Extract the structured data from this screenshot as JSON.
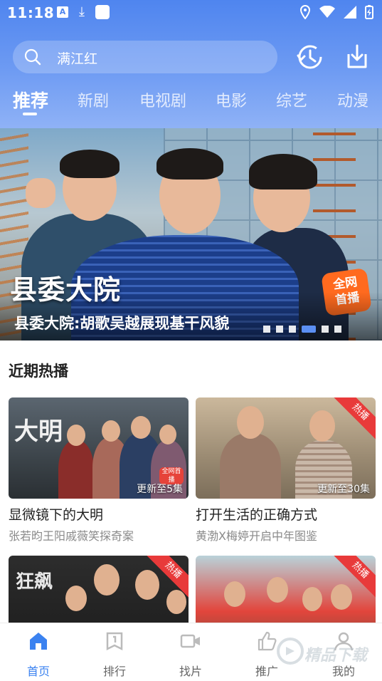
{
  "status_bar": {
    "time": "11:18",
    "left_badge": "A"
  },
  "search": {
    "placeholder": "满江红"
  },
  "tabs": [
    {
      "label": "推荐",
      "active": true
    },
    {
      "label": "新剧"
    },
    {
      "label": "电视剧"
    },
    {
      "label": "电影"
    },
    {
      "label": "综艺"
    },
    {
      "label": "动漫"
    }
  ],
  "banner": {
    "overlay_title": "县委大院",
    "caption": "县委大院:胡歌吴越展现基干风貌",
    "badge_line1": "全网",
    "badge_line2": "首播",
    "slide_count": 6,
    "active_slide": 4
  },
  "section": {
    "title": "近期热播"
  },
  "cards": [
    {
      "title": "显微镜下的大明",
      "subtitle": "张若昀王阳戚薇笑探奇案",
      "episode": "更新至5集",
      "ribbon": "",
      "thumb_text": "大明",
      "thumb_badge": "全网首播"
    },
    {
      "title": "打开生活的正确方式",
      "subtitle": "黄渤X梅婷开启中年图鉴",
      "episode": "更新至30集",
      "ribbon": "热播"
    },
    {
      "title": "",
      "subtitle": "",
      "episode": "",
      "ribbon": "热播",
      "thumb_text": "狂飙"
    },
    {
      "title": "",
      "subtitle": "",
      "episode": "",
      "ribbon": "热播"
    }
  ],
  "bottom_nav": [
    {
      "label": "首页",
      "icon": "home-icon",
      "active": true
    },
    {
      "label": "排行",
      "icon": "ranking-icon"
    },
    {
      "label": "找片",
      "icon": "video-camera-icon"
    },
    {
      "label": "推广",
      "icon": "thumbs-up-icon"
    },
    {
      "label": "我的",
      "icon": "user-icon"
    }
  ],
  "watermark": {
    "text": "精品下载"
  },
  "colors": {
    "accent": "#3b82f0",
    "header_top": "#4f85ef",
    "ribbon": "#e83a3a",
    "badge": "#ff6a1f"
  }
}
